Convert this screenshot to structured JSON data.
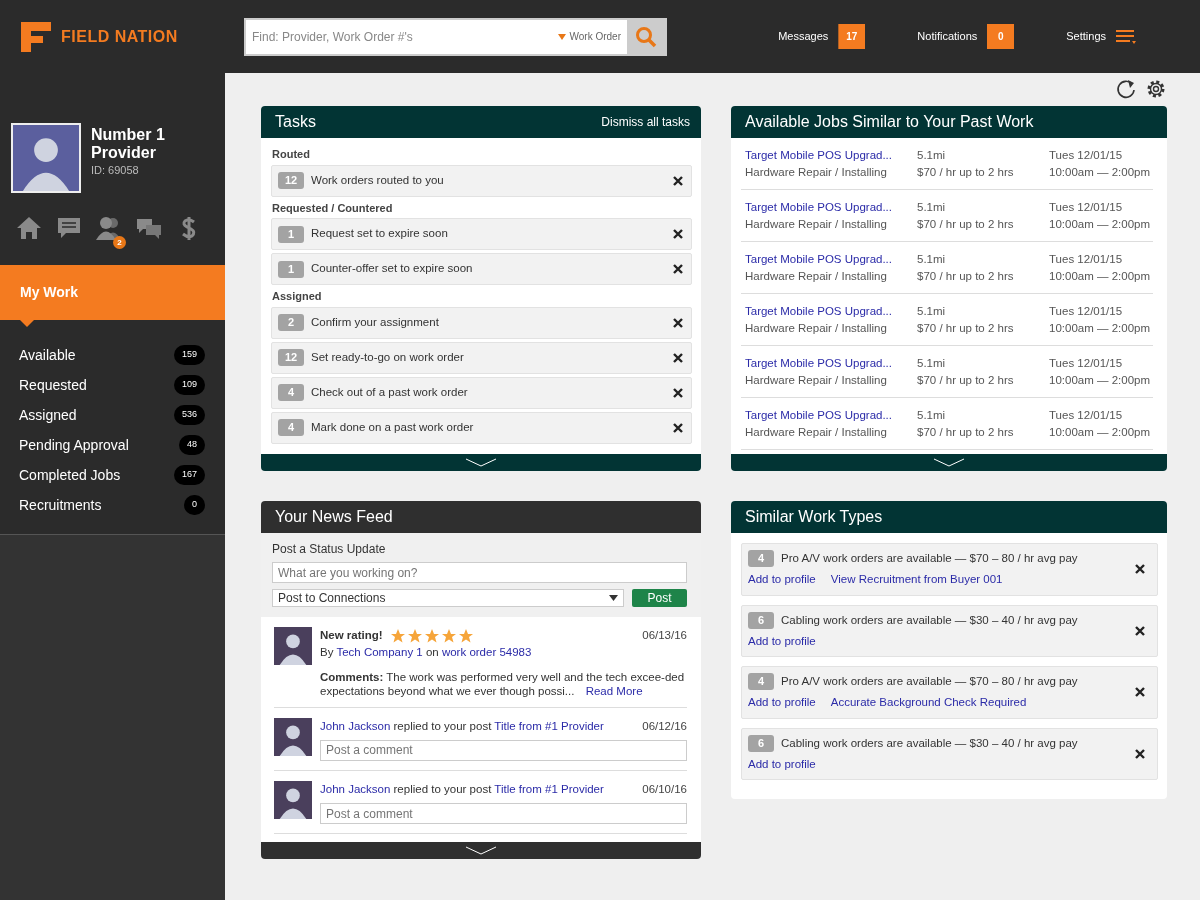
{
  "header": {
    "brand": "FIELD NATION",
    "search": {
      "placeholder": "Find: Provider, Work Order #'s",
      "scope": "Work Order"
    },
    "links": [
      {
        "label": "Messages",
        "count": "17",
        "kind": "bubble"
      },
      {
        "label": "Notifications",
        "count": "0",
        "kind": "square"
      },
      {
        "label": "Settings",
        "kind": "menu"
      }
    ]
  },
  "profile": {
    "name": "Number 1 Provider",
    "id": "ID: 69058",
    "icons": [
      {
        "kind": "home"
      },
      {
        "kind": "message"
      },
      {
        "kind": "people",
        "badge": "2"
      },
      {
        "kind": "chat"
      },
      {
        "kind": "dollar"
      }
    ]
  },
  "sidebar": {
    "section": "My Work",
    "items": [
      {
        "label": "Available",
        "count": "159"
      },
      {
        "label": "Requested",
        "count": "109"
      },
      {
        "label": "Assigned",
        "count": "536"
      },
      {
        "label": "Pending Approval",
        "count": "48"
      },
      {
        "label": "Completed Jobs",
        "count": "167"
      },
      {
        "label": "Recruitments",
        "count": "0"
      }
    ]
  },
  "tasks": {
    "title": "Tasks",
    "dismiss": "Dismiss all tasks",
    "groups": [
      {
        "heading": "Routed",
        "items": [
          {
            "count": "12",
            "text": "Work orders routed to you"
          }
        ]
      },
      {
        "heading": "Requested / Countered",
        "items": [
          {
            "count": "1",
            "text": "Request set to expire soon"
          },
          {
            "count": "1",
            "text": "Counter-offer set to expire soon"
          }
        ]
      },
      {
        "heading": "Assigned",
        "items": [
          {
            "count": "2",
            "text": "Confirm your assignment"
          },
          {
            "count": "12",
            "text": "Set ready-to-go on work order"
          },
          {
            "count": "4",
            "text": "Check out of a past work order"
          },
          {
            "count": "4",
            "text": "Mark done on a past work order"
          }
        ]
      }
    ]
  },
  "jobs": {
    "title": "Available Jobs Similar to Your Past Work",
    "rows": [
      {
        "title": "Target Mobile POS Upgrad...",
        "category": "Hardware Repair / Installing",
        "distance": "5.1mi",
        "pay": "$70 / hr up to 2 hrs",
        "date": "Tues 12/01/15",
        "time": "10:00am — 2:00pm"
      },
      {
        "title": "Target Mobile POS Upgrad...",
        "category": "Hardware Repair / Installing",
        "distance": "5.1mi",
        "pay": "$70 / hr up to 2 hrs",
        "date": "Tues 12/01/15",
        "time": "10:00am — 2:00pm"
      },
      {
        "title": "Target Mobile POS Upgrad...",
        "category": "Hardware Repair / Installing",
        "distance": "5.1mi",
        "pay": "$70 / hr up to 2 hrs",
        "date": "Tues 12/01/15",
        "time": "10:00am — 2:00pm"
      },
      {
        "title": "Target Mobile POS Upgrad...",
        "category": "Hardware Repair / Installing",
        "distance": "5.1mi",
        "pay": "$70 / hr up to 2 hrs",
        "date": "Tues 12/01/15",
        "time": "10:00am — 2:00pm"
      },
      {
        "title": "Target Mobile POS Upgrad...",
        "category": "Hardware Repair / Installing",
        "distance": "5.1mi",
        "pay": "$70 / hr up to 2 hrs",
        "date": "Tues 12/01/15",
        "time": "10:00am — 2:00pm"
      },
      {
        "title": "Target Mobile POS Upgrad...",
        "category": "Hardware Repair / Installing",
        "distance": "5.1mi",
        "pay": "$70 / hr up to 2 hrs",
        "date": "Tues 12/01/15",
        "time": "10:00am — 2:00pm"
      }
    ]
  },
  "news_feed": {
    "title": "Your News Feed",
    "status_label": "Post a Status Update",
    "status_placeholder": "What are you working on?",
    "audience": "Post to Connections",
    "post_button": "Post",
    "items": [
      {
        "kind": "rating",
        "heading": "New rating!",
        "stars": 5,
        "date": "06/13/16",
        "by": "By",
        "company": "Tech Company 1",
        "on": "on",
        "work_order": "work order 54983",
        "comment": "**Comments:** The work was performed very well and the tech excee-ded expectations beyond what we ever though possi...",
        "read_more": "Read More"
      },
      {
        "kind": "reply",
        "date": "06/12/16",
        "person": "John Jackson",
        "action": "replied to your post",
        "post": "Title from #1 Provider",
        "placeholder": "Post a comment"
      },
      {
        "kind": "reply",
        "date": "06/10/16",
        "person": "John Jackson",
        "action": "replied to your post",
        "post": "Title from #1 Provider",
        "placeholder": "Post a comment"
      }
    ]
  },
  "work_types": {
    "title": "Similar Work Types",
    "items": [
      {
        "count": "4",
        "text": "Pro A/V work orders are available — $70 – 80 / hr avg pay",
        "links": [
          "Add to profile",
          "View Recruitment from Buyer 001"
        ]
      },
      {
        "count": "6",
        "text": "Cabling work orders are available — $30 – 40 / hr avg pay",
        "links": [
          "Add to profile"
        ]
      },
      {
        "count": "4",
        "text": "Pro A/V work orders are available — $70 – 80 / hr avg pay",
        "links": [
          "Add to profile",
          "Accurate Background Check Required"
        ]
      },
      {
        "count": "6",
        "text": "Cabling work orders are available — $30 – 40 / hr avg pay",
        "links": [
          "Add to profile"
        ]
      }
    ]
  }
}
